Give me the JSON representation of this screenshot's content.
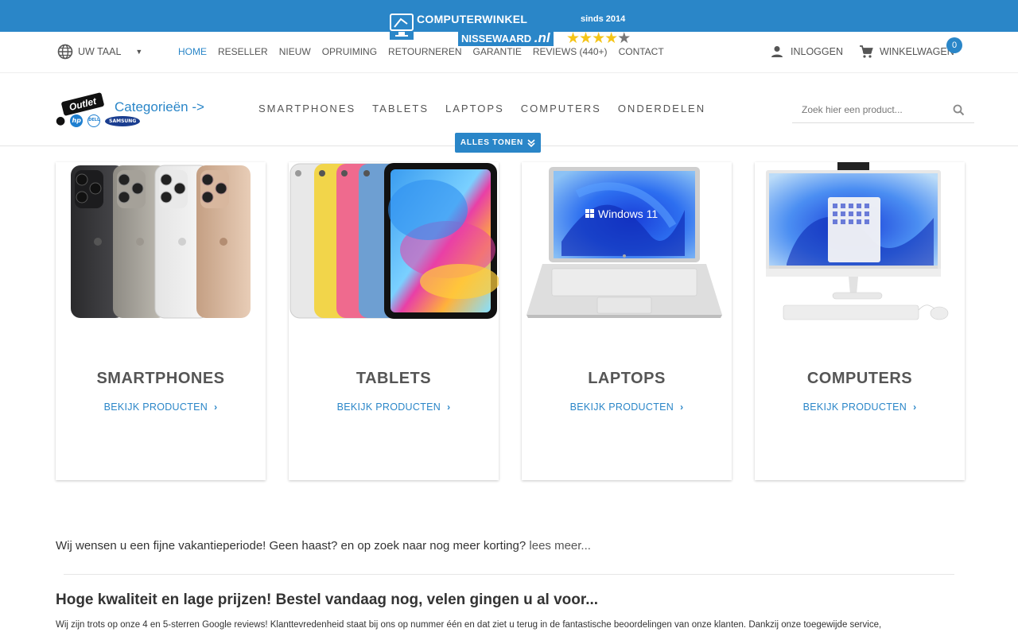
{
  "site": {
    "logo_line1": "COMPUTERWINKEL",
    "logo_line2": "NISSEWAARD",
    "logo_tld": ".nl",
    "since": "sinds 2014",
    "rating_stars": 4,
    "rating_max": 5
  },
  "topnav": {
    "language_label": "UW TAAL",
    "items": [
      {
        "label": "HOME",
        "active": true
      },
      {
        "label": "RESELLER"
      },
      {
        "label": "NIEUW"
      },
      {
        "label": "OPRUIMING"
      },
      {
        "label": "RETOURNEREN"
      },
      {
        "label": "GARANTIE"
      },
      {
        "label": "REVIEWS (440+)"
      },
      {
        "label": "CONTACT"
      }
    ],
    "login_label": "INLOGGEN",
    "cart_label": "WINKELWAGEN",
    "cart_count": "0"
  },
  "catbar": {
    "outlet_label": "Outlet",
    "brands": [
      "apple",
      "hp",
      "DELL",
      "SAMSUNG"
    ],
    "categories_link": "Categorieën ->",
    "nav": [
      "SMARTPHONES",
      "TABLETS",
      "LAPTOPS",
      "COMPUTERS",
      "ONDERDELEN"
    ],
    "search_placeholder": "Zoek hier een product...",
    "show_all": "ALLES TONEN"
  },
  "cards": [
    {
      "title": "SMARTPHONES",
      "cta": "BEKIJK PRODUCTEN"
    },
    {
      "title": "TABLETS",
      "cta": "BEKIJK PRODUCTEN"
    },
    {
      "title": "LAPTOPS",
      "cta": "BEKIJK PRODUCTEN",
      "screen_text": "Windows 11"
    },
    {
      "title": "COMPUTERS",
      "cta": "BEKIJK PRODUCTEN"
    }
  ],
  "content": {
    "vacation_text": "Wij wensen u een fijne vakantieperiode! Geen haast? en op zoek naar nog meer korting?",
    "read_more": "lees meer...",
    "headline": "Hoge kwaliteit en lage prijzen! Bestel vandaag nog, velen gingen u al voor...",
    "paragraph": "Wij zijn trots op onze 4 en 5-sterren Google reviews! Klanttevredenheid staat bij ons op nummer één en dat ziet u terug in de fantastische beoordelingen van onze klanten. Dankzij onze toegewijde service,"
  },
  "colors": {
    "brand_blue": "#2a86c8",
    "star_gold": "#f5c518"
  }
}
